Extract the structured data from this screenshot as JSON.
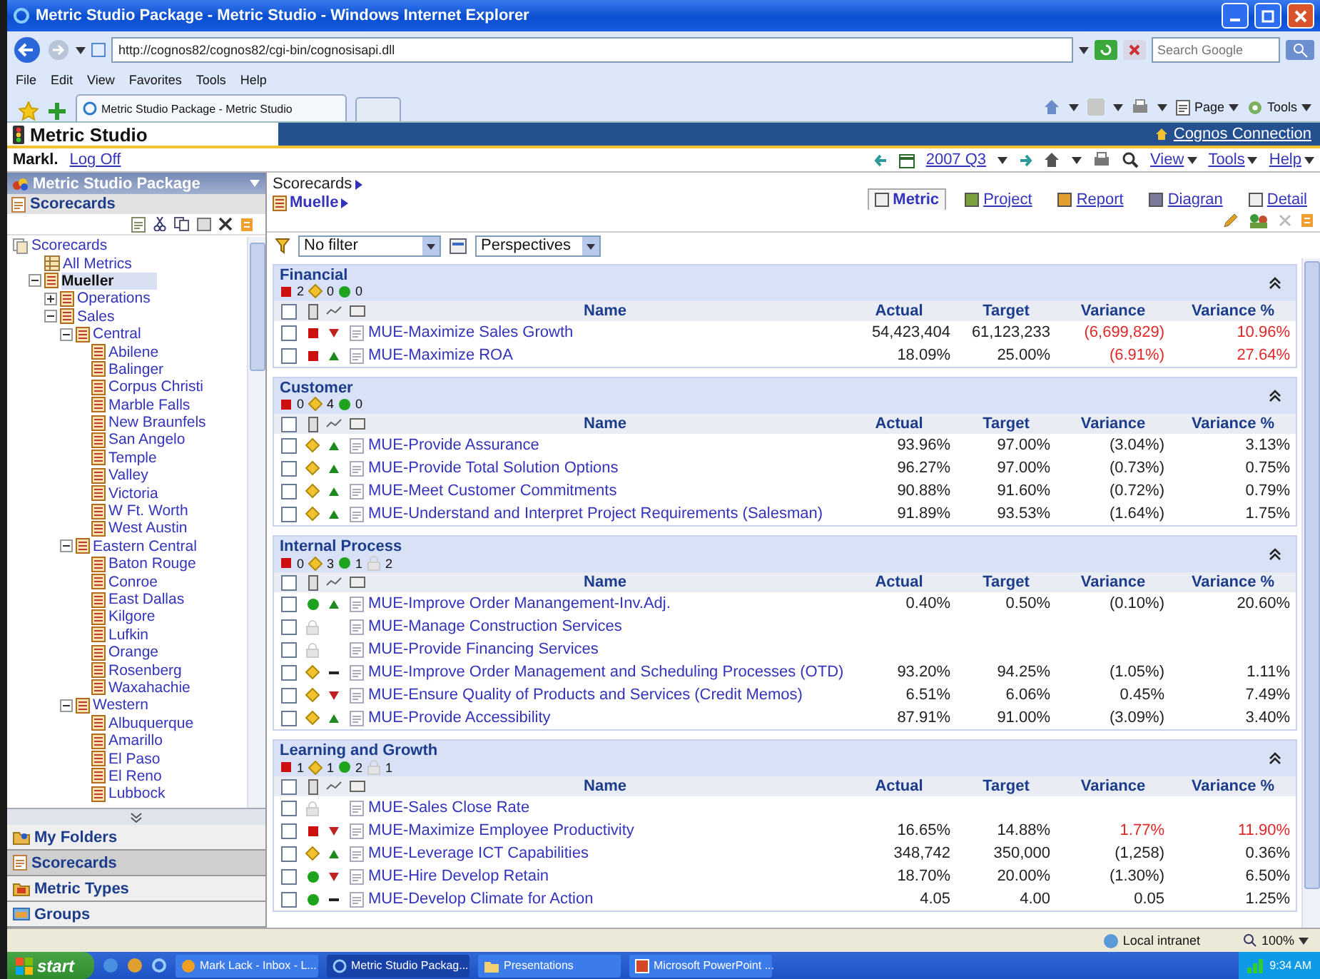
{
  "window": {
    "title": "Metric Studio Package - Metric Studio - Windows Internet Explorer"
  },
  "browser": {
    "address": "http://cognos82/cognos82/cgi-bin/cognosisapi.dll",
    "search": {
      "placeholder": "Search Google"
    },
    "menu": [
      "File",
      "Edit",
      "View",
      "Favorites",
      "Tools",
      "Help"
    ],
    "tab": "Metric Studio Package - Metric Studio",
    "tools": [
      "Page",
      "Tools"
    ]
  },
  "app": {
    "title": "Metric Studio",
    "connection_link": "Cognos Connection"
  },
  "user_bar": {
    "user": "Markl.",
    "logoff": "Log Off",
    "period": "2007 Q3",
    "menus": [
      "View",
      "Tools",
      "Help"
    ]
  },
  "sidebar": {
    "package": "Metric Studio Package",
    "heading": "Scorecards",
    "tree": [
      {
        "label": "Scorecards",
        "kind": "root",
        "selected": false,
        "children": [
          {
            "label": "All Metrics",
            "kind": "metrics",
            "selected": false
          },
          {
            "label": "Mueller",
            "kind": "scorecard",
            "selected": true,
            "expanded": true,
            "children": [
              {
                "label": "Operations",
                "kind": "scorecard",
                "selected": false,
                "expanded": false
              },
              {
                "label": "Sales",
                "kind": "scorecard",
                "selected": false,
                "expanded": true,
                "children": [
                  {
                    "label": "Central",
                    "kind": "scorecard",
                    "selected": false,
                    "expanded": true,
                    "children": [
                      {
                        "label": "Abilene",
                        "kind": "scorecard",
                        "selected": false
                      },
                      {
                        "label": "Balinger",
                        "kind": "scorecard",
                        "selected": false
                      },
                      {
                        "label": "Corpus Christi",
                        "kind": "scorecard",
                        "selected": false
                      },
                      {
                        "label": "Marble Falls",
                        "kind": "scorecard",
                        "selected": false
                      },
                      {
                        "label": "New Braunfels",
                        "kind": "scorecard",
                        "selected": false
                      },
                      {
                        "label": "San Angelo",
                        "kind": "scorecard",
                        "selected": false
                      },
                      {
                        "label": "Temple",
                        "kind": "scorecard",
                        "selected": false
                      },
                      {
                        "label": "Valley",
                        "kind": "scorecard",
                        "selected": false
                      },
                      {
                        "label": "Victoria",
                        "kind": "scorecard",
                        "selected": false
                      },
                      {
                        "label": "W Ft. Worth",
                        "kind": "scorecard",
                        "selected": false
                      },
                      {
                        "label": "West Austin",
                        "kind": "scorecard",
                        "selected": false
                      }
                    ]
                  },
                  {
                    "label": "Eastern Central",
                    "kind": "scorecard",
                    "selected": false,
                    "expanded": true,
                    "children": [
                      {
                        "label": "Baton Rouge",
                        "kind": "scorecard",
                        "selected": false
                      },
                      {
                        "label": "Conroe",
                        "kind": "scorecard",
                        "selected": false
                      },
                      {
                        "label": "East Dallas",
                        "kind": "scorecard",
                        "selected": false
                      },
                      {
                        "label": "Kilgore",
                        "kind": "scorecard",
                        "selected": false
                      },
                      {
                        "label": "Lufkin",
                        "kind": "scorecard",
                        "selected": false
                      },
                      {
                        "label": "Orange",
                        "kind": "scorecard",
                        "selected": false
                      },
                      {
                        "label": "Rosenberg",
                        "kind": "scorecard",
                        "selected": false
                      },
                      {
                        "label": "Waxahachie",
                        "kind": "scorecard",
                        "selected": false
                      }
                    ]
                  },
                  {
                    "label": "Western",
                    "kind": "scorecard",
                    "selected": false,
                    "expanded": true,
                    "children": [
                      {
                        "label": "Albuquerque",
                        "kind": "scorecard",
                        "selected": false
                      },
                      {
                        "label": "Amarillo",
                        "kind": "scorecard",
                        "selected": false
                      },
                      {
                        "label": "El Paso",
                        "kind": "scorecard",
                        "selected": false
                      },
                      {
                        "label": "El Reno",
                        "kind": "scorecard",
                        "selected": false
                      },
                      {
                        "label": "Lubbock",
                        "kind": "scorecard",
                        "selected": false
                      }
                    ]
                  }
                ]
              }
            ]
          }
        ]
      }
    ],
    "panes": [
      {
        "label": "My Folders",
        "kind": "folders",
        "selected": false
      },
      {
        "label": "Scorecards",
        "kind": "scorecards",
        "selected": true
      },
      {
        "label": "Metric Types",
        "kind": "types",
        "selected": false
      },
      {
        "label": "Groups",
        "kind": "groups",
        "selected": false
      }
    ]
  },
  "breadcrumbs": [
    "Scorecards",
    "Muelle"
  ],
  "view_tabs": [
    {
      "label": "Metric",
      "selected": true
    },
    {
      "label": "Project",
      "selected": false
    },
    {
      "label": "Report",
      "selected": false
    },
    {
      "label": "Diagran",
      "selected": false
    },
    {
      "label": "Detail",
      "selected": false
    }
  ],
  "filter": {
    "value": "No filter"
  },
  "grouping": {
    "value": "Perspectives"
  },
  "sections": [
    {
      "title": "Financial",
      "all_checked": false,
      "counts": [
        {
          "kind": "red",
          "count": "2"
        },
        {
          "kind": "yellow",
          "count": "0"
        },
        {
          "kind": "green",
          "count": "0"
        }
      ],
      "columns": [
        "Name",
        "Actual",
        "Target",
        "Variance",
        "Variance %"
      ],
      "rows": [
        {
          "checked": false,
          "status": {
            "kind": "red"
          },
          "trend": {
            "kind": "down"
          },
          "name": "MUE-Maximize Sales Growth",
          "actual": "54,423,404",
          "target": "61,123,233",
          "variance": "(6,699,829)",
          "variance_pct": "10.96%",
          "alert": true
        },
        {
          "checked": false,
          "status": {
            "kind": "red"
          },
          "trend": {
            "kind": "up"
          },
          "name": "MUE-Maximize ROA",
          "actual": "18.09%",
          "target": "25.00%",
          "variance": "(6.91%)",
          "variance_pct": "27.64%",
          "alert": true
        }
      ]
    },
    {
      "title": "Customer",
      "all_checked": false,
      "counts": [
        {
          "kind": "red",
          "count": "0"
        },
        {
          "kind": "yellow",
          "count": "4"
        },
        {
          "kind": "green",
          "count": "0"
        }
      ],
      "columns": [
        "Name",
        "Actual",
        "Target",
        "Variance",
        "Variance %"
      ],
      "rows": [
        {
          "checked": false,
          "status": {
            "kind": "yellow"
          },
          "trend": {
            "kind": "up"
          },
          "name": "MUE-Provide Assurance",
          "actual": "93.96%",
          "target": "97.00%",
          "variance": "(3.04%)",
          "variance_pct": "3.13%",
          "alert": false
        },
        {
          "checked": false,
          "status": {
            "kind": "yellow"
          },
          "trend": {
            "kind": "up"
          },
          "name": "MUE-Provide Total Solution Options",
          "actual": "96.27%",
          "target": "97.00%",
          "variance": "(0.73%)",
          "variance_pct": "0.75%",
          "alert": false
        },
        {
          "checked": false,
          "status": {
            "kind": "yellow"
          },
          "trend": {
            "kind": "up"
          },
          "name": "MUE-Meet Customer Commitments",
          "actual": "90.88%",
          "target": "91.60%",
          "variance": "(0.72%)",
          "variance_pct": "0.79%",
          "alert": false
        },
        {
          "checked": false,
          "status": {
            "kind": "yellow"
          },
          "trend": {
            "kind": "up"
          },
          "name": "MUE-Understand and Interpret Project Requirements (Salesman)",
          "actual": "91.89%",
          "target": "93.53%",
          "variance": "(1.64%)",
          "variance_pct": "1.75%",
          "alert": false
        }
      ]
    },
    {
      "title": "Internal Process",
      "all_checked": false,
      "counts": [
        {
          "kind": "red",
          "count": "0"
        },
        {
          "kind": "yellow",
          "count": "3"
        },
        {
          "kind": "green",
          "count": "1"
        },
        {
          "kind": "lock",
          "count": "2"
        }
      ],
      "columns": [
        "Name",
        "Actual",
        "Target",
        "Variance",
        "Variance %"
      ],
      "rows": [
        {
          "checked": false,
          "status": {
            "kind": "green"
          },
          "trend": {
            "kind": "up"
          },
          "name": "MUE-Improve Order Manangement-Inv.Adj.",
          "actual": "0.40%",
          "target": "0.50%",
          "variance": "(0.10%)",
          "variance_pct": "20.60%",
          "alert": false
        },
        {
          "checked": false,
          "status": {
            "kind": "lock"
          },
          "name": "MUE-Manage Construction Services"
        },
        {
          "checked": false,
          "status": {
            "kind": "lock"
          },
          "name": "MUE-Provide Financing Services"
        },
        {
          "checked": false,
          "status": {
            "kind": "yellow"
          },
          "trend": {
            "kind": "flat"
          },
          "name": "MUE-Improve Order Management and Scheduling Processes (OTD)",
          "actual": "93.20%",
          "target": "94.25%",
          "variance": "(1.05%)",
          "variance_pct": "1.11%",
          "alert": false
        },
        {
          "checked": false,
          "status": {
            "kind": "yellow"
          },
          "trend": {
            "kind": "down"
          },
          "name": "MUE-Ensure Quality of Products and Services (Credit Memos)",
          "actual": "6.51%",
          "target": "6.06%",
          "variance": "0.45%",
          "variance_pct": "7.49%",
          "alert": false
        },
        {
          "checked": false,
          "status": {
            "kind": "yellow"
          },
          "trend": {
            "kind": "up"
          },
          "name": "MUE-Provide Accessibility",
          "actual": "87.91%",
          "target": "91.00%",
          "variance": "(3.09%)",
          "variance_pct": "3.40%",
          "alert": false
        }
      ]
    },
    {
      "title": "Learning and Growth",
      "all_checked": false,
      "counts": [
        {
          "kind": "red",
          "count": "1"
        },
        {
          "kind": "yellow",
          "count": "1"
        },
        {
          "kind": "green",
          "count": "2"
        },
        {
          "kind": "lock",
          "count": "1"
        }
      ],
      "columns": [
        "Name",
        "Actual",
        "Target",
        "Variance",
        "Variance %"
      ],
      "rows": [
        {
          "checked": false,
          "status": {
            "kind": "lock"
          },
          "name": "MUE-Sales Close Rate"
        },
        {
          "checked": false,
          "status": {
            "kind": "red"
          },
          "trend": {
            "kind": "down"
          },
          "name": "MUE-Maximize Employee Productivity",
          "actual": "16.65%",
          "target": "14.88%",
          "variance": "1.77%",
          "variance_pct": "11.90%",
          "alert": true
        },
        {
          "checked": false,
          "status": {
            "kind": "yellow"
          },
          "trend": {
            "kind": "up"
          },
          "name": "MUE-Leverage ICT Capabilities",
          "actual": "348,742",
          "target": "350,000",
          "variance": "(1,258)",
          "variance_pct": "0.36%",
          "alert": false
        },
        {
          "checked": false,
          "status": {
            "kind": "green"
          },
          "trend": {
            "kind": "down"
          },
          "name": "MUE-Hire Develop Retain",
          "actual": "18.70%",
          "target": "20.00%",
          "variance": "(1.30%)",
          "variance_pct": "6.50%",
          "alert": false
        },
        {
          "checked": false,
          "status": {
            "kind": "green"
          },
          "trend": {
            "kind": "flat"
          },
          "name": "MUE-Develop Climate for Action",
          "actual": "4.05",
          "target": "4.00",
          "variance": "0.05",
          "variance_pct": "1.25%",
          "alert": false
        }
      ]
    }
  ],
  "status_bar": {
    "zone": "Local intranet",
    "zoom": "100%"
  },
  "taskbar": {
    "start": "start",
    "items": [
      {
        "label": "Mark Lack - Inbox - L...",
        "kind": "mail",
        "selected": false
      },
      {
        "label": "Metric Studio Packag...",
        "kind": "browser",
        "selected": true
      },
      {
        "label": "Presentations",
        "kind": "folder",
        "selected": false
      },
      {
        "label": "Microsoft PowerPoint ...",
        "kind": "slides",
        "selected": false
      }
    ],
    "clock": "9:34 AM"
  }
}
